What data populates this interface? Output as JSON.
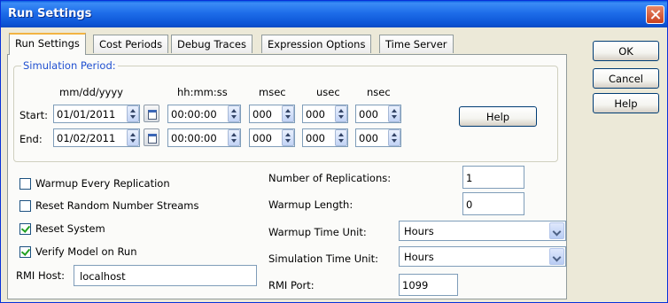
{
  "window": {
    "title": "Run Settings"
  },
  "tabs": [
    {
      "label": "Run Settings",
      "selected": true
    },
    {
      "label": "Cost Periods"
    },
    {
      "label": "Debug Traces"
    },
    {
      "label": "Expression Options"
    },
    {
      "label": "Time Server"
    }
  ],
  "dialog_buttons": {
    "ok": "OK",
    "cancel": "Cancel",
    "help": "Help"
  },
  "simulation_period": {
    "label": "Simulation Period:",
    "headers": {
      "date": "mm/dd/yyyy",
      "time": "hh:mm:ss",
      "msec": "msec",
      "usec": "usec",
      "nsec": "nsec"
    },
    "start": {
      "label": "Start:",
      "date": "01/01/2011",
      "time": "00:00:00",
      "msec": "000",
      "usec": "000",
      "nsec": "000"
    },
    "end": {
      "label": "End:",
      "date": "01/02/2011",
      "time": "00:00:00",
      "msec": "000",
      "usec": "000",
      "nsec": "000"
    },
    "help_label": "Help"
  },
  "options": {
    "warmup_every_replication": {
      "label": "Warmup Every Replication",
      "checked": false
    },
    "reset_random_number_streams": {
      "label": "Reset Random Number Streams",
      "checked": false
    },
    "reset_system": {
      "label": "Reset System",
      "checked": true
    },
    "verify_model_on_run": {
      "label": "Verify Model on Run",
      "checked": true
    }
  },
  "rmi_host": {
    "label": "RMI Host:",
    "value": "localhost"
  },
  "number_of_replications": {
    "label": "Number of Replications:",
    "value": "1"
  },
  "warmup_length": {
    "label": "Warmup Length:",
    "value": "0"
  },
  "warmup_time_unit": {
    "label": "Warmup Time Unit:",
    "value": "Hours"
  },
  "simulation_time_unit": {
    "label": "Simulation Time Unit:",
    "value": "Hours"
  },
  "rmi_port": {
    "label": "RMI Port:",
    "value": "1099"
  },
  "colors": {
    "title_bar": "#0a5fe0",
    "group_label": "#2050d0",
    "face": "#ece9d8"
  }
}
